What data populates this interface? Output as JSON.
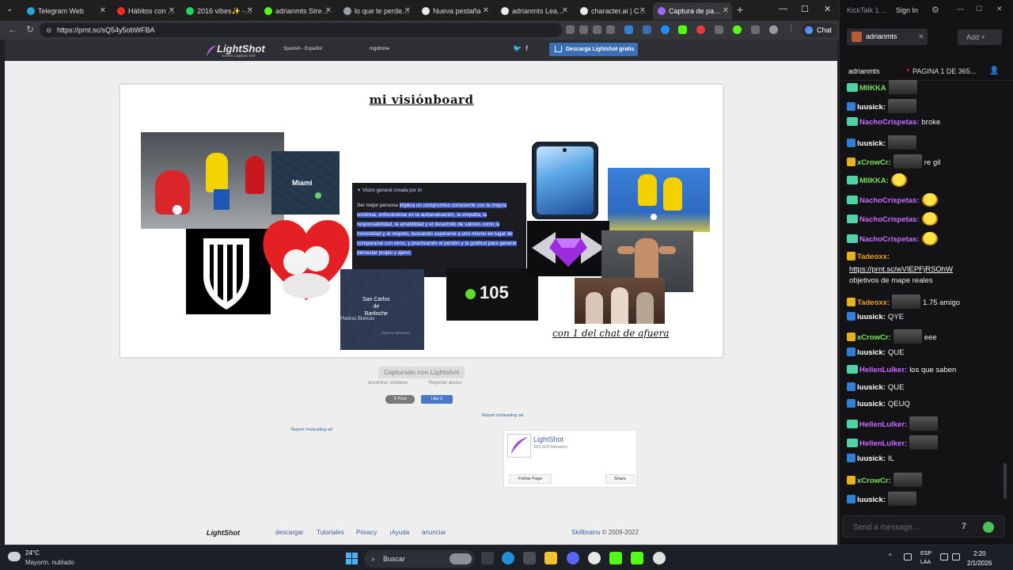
{
  "browser": {
    "tabs": [
      {
        "label": "Telegram Web",
        "color": "#2aa3e1"
      },
      {
        "label": "Hábitos con Yosoyp",
        "color": "#ff2b2b"
      },
      {
        "label": "2016 vibes✨ - pla",
        "color": "#1ed760"
      },
      {
        "label": "adrianmts Stream",
        "color": "#53fc18"
      },
      {
        "label": "lo que te perdes p",
        "color": "#9aa0a6"
      },
      {
        "label": "Nueva pestaña",
        "color": "#e8eaed"
      },
      {
        "label": "adrianmts Leaderb",
        "color": "#e8eaed"
      },
      {
        "label": "character.ai | Chat",
        "color": "#e8eaed"
      },
      {
        "label": "Captura de pantall",
        "color": "#9b6cff"
      }
    ],
    "url": "https://prnt.sc/sQ54y5obWFBA",
    "chat_button": "Chat"
  },
  "lightshot": {
    "logo": "LightShot",
    "logo_sub": "screen capture tool",
    "language": "Spanish - Español",
    "user": "mgdmme",
    "download_label": "Descarga Lightshot gratis",
    "screenshot": {
      "title": "mi visiónboard",
      "caption": "con 1 del chat de afuera",
      "map1_label": "Miami",
      "map2_label": "San Carlos\nde\nBariloche",
      "map2_label2": "Piedras Blancas",
      "map2_label3": "PUERTO MORENO",
      "counter_value": "105",
      "ai_heading": "Visión general creada por IA",
      "ai_text_plain": "Ser mejor persona ",
      "ai_text_highlight": "implica un compromiso consciente con la mejora continua, enfocándose en la autoevaluación, la empatía, la responsabilidad, la amabilidad y el desarrollo de valores como la honestidad y el respeto, buscando superarse a uno mismo en lugar de compararse con otros, y practicando el perdón y la gratitud para generar bienestar propio y ajeno."
    },
    "captured_label": "Capturado con Lightshot",
    "find_similar": "encontrar similares",
    "report_abuse": "Reportar abuso",
    "tweet": "X Post",
    "like": "Like 0",
    "report_ad": "Report misleading ad",
    "fb_widget": {
      "name": "LightShot",
      "followers": "383,509 followers",
      "follow": "Follow Page",
      "share": "Share"
    },
    "footer": {
      "logo": "LightShot",
      "links": [
        "descargar",
        "Tutoriales",
        "Privacy",
        "¡Ayuda",
        "anunciar"
      ],
      "brand": "Skillbrains",
      "copyright": " © 2009-2022"
    }
  },
  "kicktalk": {
    "app_title": "KickTalk 1....",
    "signin": "Sign In",
    "channel_tab": "adrianmts",
    "add_label": "Add",
    "header_channel": "adrianmts",
    "header_page": "PAGINA 1 DE 365...",
    "messages": [
      {
        "user": "MIIKKA",
        "color": "#7ee05a",
        "text": "",
        "emote": true
      },
      {
        "user": "luusick:",
        "color": "#ffffff",
        "text": "",
        "emote": true
      },
      {
        "user": "NachoCrispetas:",
        "color": "#c86bff",
        "text": "broke",
        "emote": false
      },
      {
        "user": "luusick:",
        "color": "#ffffff",
        "text": "",
        "emote": true
      },
      {
        "user": "xCrowCr:",
        "color": "#7ee05a",
        "text": "re gil",
        "emote": true
      },
      {
        "user": "MIIKKA:",
        "color": "#7ee05a",
        "text": "",
        "emote": true
      },
      {
        "user": "NachoCrispetas:",
        "color": "#c86bff",
        "text": "",
        "emote": true
      },
      {
        "user": "NachoCrispetas:",
        "color": "#c86bff",
        "text": "",
        "emote": true
      },
      {
        "user": "NachoCrispetas:",
        "color": "#c86bff",
        "text": "",
        "emote": true
      },
      {
        "user": "Tadeoxx:",
        "color": "#f0a020",
        "text": "",
        "emote": false
      },
      {
        "user": "",
        "color": "#ffffff",
        "text": "https://prnt.sc/wVIEPFjRSOhW",
        "emote": false
      },
      {
        "user": "",
        "color": "#ffffff",
        "text": "objetivos de mape reales",
        "emote": false
      },
      {
        "user": "Tadeoxx:",
        "color": "#f0a020",
        "text": "1.75 amigo",
        "emote": true
      },
      {
        "user": "luusick:",
        "color": "#ffffff",
        "text": "QYE",
        "emote": false
      },
      {
        "user": "xCrowCr:",
        "color": "#7ee05a",
        "text": "eee",
        "emote": true
      },
      {
        "user": "luusick:",
        "color": "#ffffff",
        "text": "QUE",
        "emote": false
      },
      {
        "user": "HellenLulker:",
        "color": "#c86bff",
        "text": "los que saben",
        "emote": false
      },
      {
        "user": "luusick:",
        "color": "#ffffff",
        "text": "QUE",
        "emote": false
      },
      {
        "user": "luusick:",
        "color": "#ffffff",
        "text": "QEUQ",
        "emote": false
      },
      {
        "user": "HellenLulker:",
        "color": "#c86bff",
        "text": "",
        "emote": true
      },
      {
        "user": "HellenLulker:",
        "color": "#c86bff",
        "text": "",
        "emote": true
      },
      {
        "user": "luusick:",
        "color": "#ffffff",
        "text": "IL",
        "emote": false
      },
      {
        "user": "xCrowCr:",
        "color": "#7ee05a",
        "text": "",
        "emote": true
      },
      {
        "user": "luusick:",
        "color": "#ffffff",
        "text": "",
        "emote": true
      }
    ],
    "input_placeholder": "Send a message..."
  },
  "taskbar": {
    "temp": "24°C",
    "weather": "Mayorm. nublado",
    "search": "Buscar",
    "lang1": "ESP",
    "lang2": "LAA",
    "time": "2:20",
    "date": "2/1/2026"
  }
}
